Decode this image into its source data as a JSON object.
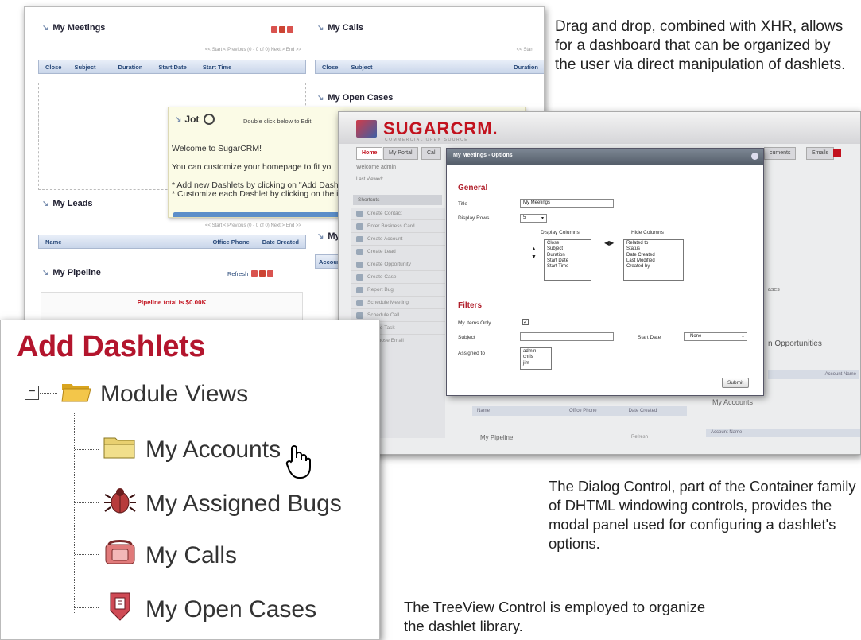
{
  "captions": {
    "dragdrop": "Drag and drop, combined with XHR, allows for a dashboard that can be organized by the user via direct manipulation of dashlets.",
    "dialog": "The Dialog Control, part of the Container family of DHTML windowing controls, provides the modal panel used for configuring a dashlet's options.",
    "treeview": "The TreeView Control is employed to organize the dashlet library."
  },
  "dashboard": {
    "meetings": {
      "title": "My Meetings",
      "pager": "<< Start  < Previous  (0 - 0 of 0)  Next >  End >>",
      "columns": [
        "Close",
        "Subject",
        "Duration",
        "Start Date",
        "Start Time"
      ]
    },
    "calls": {
      "title": "My Calls",
      "pager": "<< Start",
      "columns": [
        "Close",
        "Subject",
        "Duration"
      ]
    },
    "open_cases": {
      "title": "My Open Cases"
    },
    "leads": {
      "title": "My Leads",
      "pager": "<< Start  < Previous  (0 - 0 of 0)  Next >  End >>",
      "columns": [
        "Name",
        "Office Phone",
        "Date Created"
      ]
    },
    "accounts_partial": {
      "title": "My A",
      "col": "Accoun"
    },
    "pipeline": {
      "title": "My Pipeline",
      "refresh": "Refresh",
      "total": "Pipeline total is $0.00K"
    },
    "jot": {
      "title": "Jot",
      "hint": "Double click below to Edit.",
      "lines": [
        "Welcome to SugarCRM!",
        "You can customize your homepage to fit yo",
        "* Add new Dashlets by clicking on \"Add Dash",
        "* Customize each Dashlet by clicking on the i"
      ]
    }
  },
  "sugar": {
    "logo": "SUGARCRM.",
    "logo_sub": "COMMERCIAL OPEN SOURCE",
    "tabs": [
      "Home",
      "My Portal",
      "Cal"
    ],
    "tabs_right": [
      "cuments",
      "Emails"
    ],
    "welcome": "Welcome admin",
    "last_viewed": "Last Viewed:",
    "shortcuts_title": "Shortcuts",
    "shortcuts": [
      "Create Contact",
      "Enter Business Card",
      "Create Account",
      "Create Lead",
      "Create Opportunity",
      "Create Case",
      "Report Bug",
      "Schedule Meeting",
      "Schedule Call",
      "Create Task",
      "Compose Email"
    ],
    "bg_labels": {
      "opportunities": "n Opportunities",
      "accounts": "My Accounts",
      "pipeline": "My Pipeline",
      "refresh": "Refresh",
      "name": "Name",
      "office_phone": "Office Phone",
      "date_created": "Date Created",
      "account_name": "Account Name",
      "account_name2": "Account Name",
      "cases": "ases"
    },
    "dialog": {
      "title": "My Meetings - Options",
      "general": "General",
      "title_label": "Title",
      "title_value": "My Meetings",
      "rows_label": "Display Rows",
      "rows_value": "5",
      "display_columns": "Display Columns",
      "hide_columns": "Hide Columns",
      "display_list": [
        "Close",
        "Subject",
        "Duration",
        "Start Date",
        "Start Time"
      ],
      "hide_list": [
        "Related to",
        "Status",
        "Date Created",
        "Last Modified",
        "Created by"
      ],
      "filters": "Filters",
      "my_items_label": "My Items Only",
      "subject_label": "Subject",
      "start_date_label": "Start Date",
      "start_date_value": "--None--",
      "assigned_label": "Assigned to",
      "assigned_list": [
        "admin",
        "chris",
        "jim"
      ],
      "submit": "Submit"
    }
  },
  "tree": {
    "title": "Add Dashlets",
    "root": "Module Views",
    "items": [
      {
        "label": "My Accounts",
        "icon": "folder-icon"
      },
      {
        "label": "My Assigned Bugs",
        "icon": "bug-icon"
      },
      {
        "label": "My Calls",
        "icon": "phone-icon"
      },
      {
        "label": "My Open Cases",
        "icon": "case-icon"
      }
    ]
  }
}
